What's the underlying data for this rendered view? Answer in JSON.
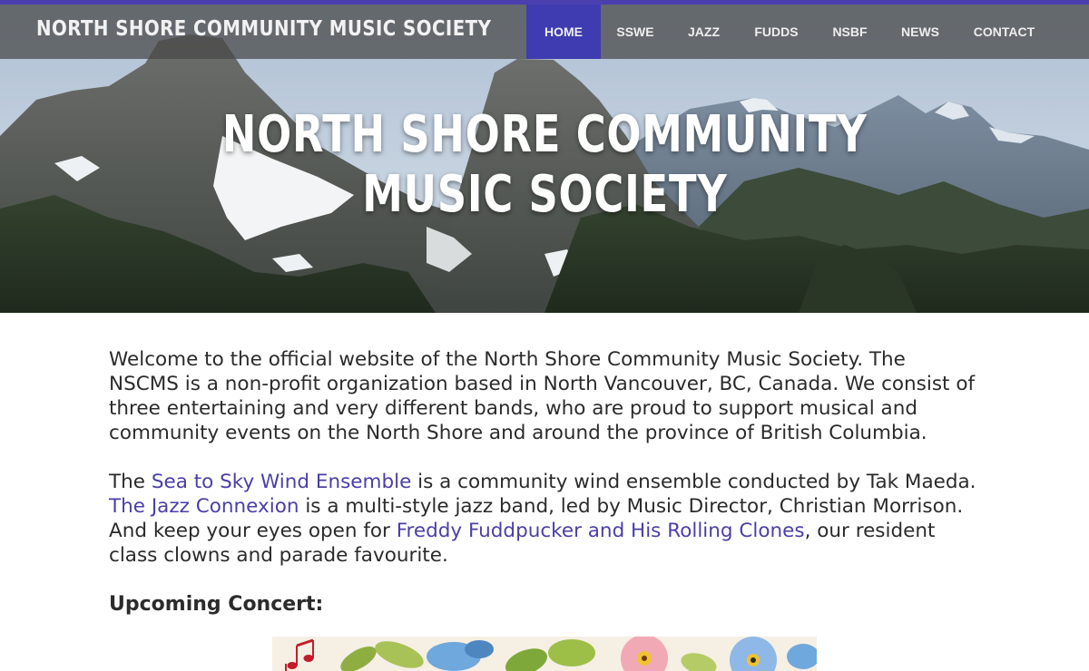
{
  "header": {
    "site_title": "NORTH SHORE COMMUNITY MUSIC SOCIETY",
    "accent_color": "#3f3bb0"
  },
  "nav": {
    "items": [
      {
        "label": "HOME",
        "active": true
      },
      {
        "label": "SSWE",
        "active": false
      },
      {
        "label": "JAZZ",
        "active": false
      },
      {
        "label": "FUDDS",
        "active": false
      },
      {
        "label": "NSBF",
        "active": false
      },
      {
        "label": "NEWS",
        "active": false
      },
      {
        "label": "CONTACT",
        "active": false
      }
    ]
  },
  "hero": {
    "line1": "NORTH SHORE COMMUNITY",
    "line2": "MUSIC SOCIETY"
  },
  "intro": {
    "text": "Welcome to the official website of the North Shore Community Music Society. The NSCMS is a non-profit organization based in North Vancouver, BC, Canada. We consist of three entertaining and very different bands, who are proud to support musical and community events on the North Shore and around the province of British Columbia."
  },
  "bands": {
    "t1": "The ",
    "link1": "Sea to Sky Wind Ensemble",
    "t2": " is a community wind ensemble conducted by Tak Maeda. ",
    "link2": "The Jazz Connexion",
    "t3": " is a multi-style jazz band, led by Music Director, Christian Morrison. And keep your eyes open for ",
    "link3": "Freddy Fuddpucker and His Rolling Clones",
    "t4": ", our resident class clowns and parade favourite."
  },
  "concert": {
    "heading": "Upcoming Concert:"
  },
  "colors": {
    "link": "#4a3fa8",
    "text": "#2b2b2b"
  }
}
